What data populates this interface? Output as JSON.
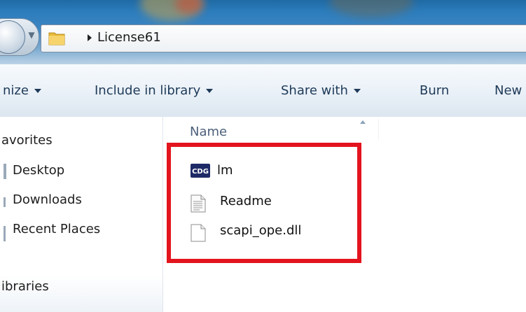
{
  "address_bar": {
    "breadcrumb": "License61"
  },
  "toolbar": {
    "items": [
      {
        "label": "nize",
        "has_dropdown": true
      },
      {
        "label": "Include in library",
        "has_dropdown": true
      },
      {
        "label": "Share with",
        "has_dropdown": true
      },
      {
        "label": "Burn",
        "has_dropdown": false
      },
      {
        "label": "New",
        "has_dropdown": false
      }
    ]
  },
  "nav_pane": {
    "favorites_label": "avorites",
    "favorites": [
      {
        "label": "Desktop"
      },
      {
        "label": "Downloads"
      },
      {
        "label": "Recent Places"
      }
    ],
    "libraries_label": "ibraries"
  },
  "file_list": {
    "column_name": "Name",
    "files": [
      {
        "name": "lm",
        "icon": "cdg-app-icon"
      },
      {
        "name": "Readme",
        "icon": "text-file-icon"
      },
      {
        "name": "scapi_ope.dll",
        "icon": "generic-file-icon"
      }
    ]
  },
  "colors": {
    "highlight": "#e3141e",
    "toolbar_text": "#1e3a58"
  }
}
